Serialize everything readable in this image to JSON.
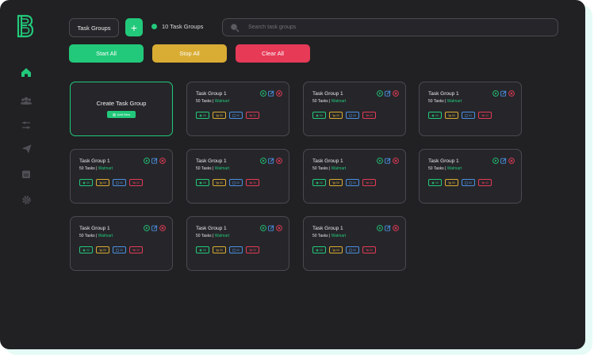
{
  "app": {
    "brand_letter": "B"
  },
  "sidebar": {
    "items": [
      {
        "name": "home-icon",
        "active": true
      },
      {
        "name": "users-icon",
        "active": false
      },
      {
        "name": "sliders-icon",
        "active": false
      },
      {
        "name": "send-icon",
        "active": false
      },
      {
        "name": "calendar-icon",
        "active": false
      },
      {
        "name": "gear-icon",
        "active": false
      }
    ]
  },
  "header": {
    "task_groups_label": "Task Groups",
    "add_label": "+",
    "count_label": "10 Task Groups",
    "search_placeholder": "Search task groups"
  },
  "actions": {
    "start_all": "Start All",
    "stop_all": "Stop All",
    "clear_all": "Clear All"
  },
  "create_card": {
    "title": "Create Task Group",
    "add_new": "Add New"
  },
  "cards": [
    {
      "title": "Task Group 1",
      "tasks": "50 Tasks",
      "sep": "|",
      "store": "Walmart",
      "badges": [
        "00",
        "00",
        "00",
        "00"
      ]
    },
    {
      "title": "Task Group 1",
      "tasks": "50 Tasks",
      "sep": "|",
      "store": "Walmart",
      "badges": [
        "00",
        "00",
        "00",
        "00"
      ]
    },
    {
      "title": "Task Group 1",
      "tasks": "50 Tasks",
      "sep": "|",
      "store": "Walmart",
      "badges": [
        "00",
        "00",
        "00",
        "00"
      ]
    },
    {
      "title": "Task Group 1",
      "tasks": "50 Tasks",
      "sep": "|",
      "store": "Walmart",
      "badges": [
        "00",
        "00",
        "00",
        "00"
      ]
    },
    {
      "title": "Task Group 1",
      "tasks": "50 Tasks",
      "sep": "|",
      "store": "Walmart",
      "badges": [
        "00",
        "00",
        "00",
        "00"
      ]
    },
    {
      "title": "Task Group 1",
      "tasks": "50 Tasks",
      "sep": "|",
      "store": "Walmart",
      "badges": [
        "00",
        "00",
        "00",
        "00"
      ]
    },
    {
      "title": "Task Group 1",
      "tasks": "50 Tasks",
      "sep": "|",
      "store": "Walmart",
      "badges": [
        "00",
        "00",
        "00",
        "00"
      ]
    },
    {
      "title": "Task Group 1",
      "tasks": "50 Tasks",
      "sep": "|",
      "store": "Walmart",
      "badges": [
        "00",
        "00",
        "00",
        "00"
      ]
    },
    {
      "title": "Task Group 1",
      "tasks": "50 Tasks",
      "sep": "|",
      "store": "Walmart",
      "badges": [
        "00",
        "00",
        "00",
        "00"
      ]
    },
    {
      "title": "Task Group 1",
      "tasks": "50 Tasks",
      "sep": "|",
      "store": "Walmart",
      "badges": [
        "00",
        "00",
        "00",
        "00"
      ]
    }
  ],
  "colors": {
    "accent_green": "#22c97a",
    "accent_yellow": "#d9ac33",
    "accent_red": "#e63a57",
    "accent_blue": "#4a90e2",
    "background": "#212124"
  }
}
